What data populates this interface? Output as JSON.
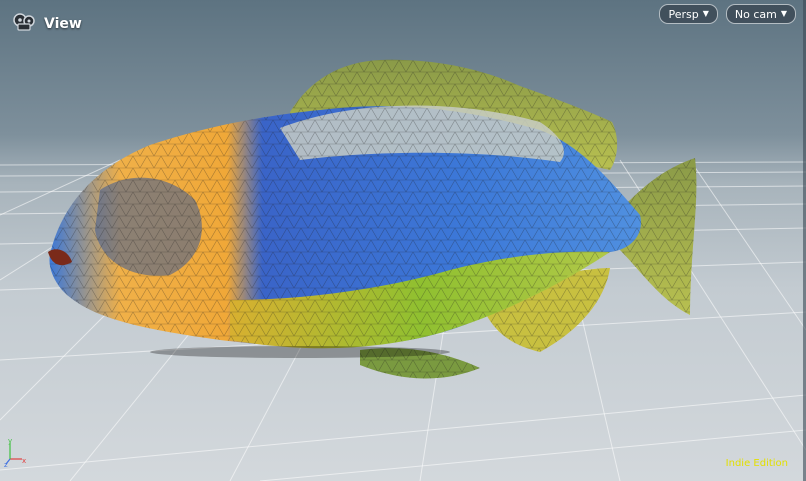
{
  "viewport": {
    "title": "View",
    "projection_label": "Persp",
    "camera_label": "No cam",
    "watermark": "Indie Edition",
    "axis_labels": {
      "x": "x",
      "y": "y",
      "z": "z"
    }
  },
  "colors": {
    "accent_watermark": "#e3e000",
    "x_axis": "#e04040",
    "y_axis": "#40c040",
    "z_axis": "#4070e0"
  },
  "icons": {
    "view_menu": "camera-reel-icon",
    "projection_dropdown": "chevron-down-icon",
    "camera_dropdown": "chevron-down-icon"
  }
}
